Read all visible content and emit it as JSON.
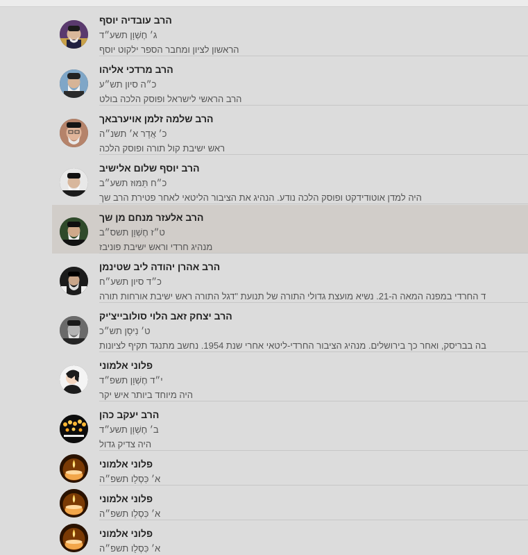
{
  "entries": [
    {
      "name": "הרב עובדיה יוסף",
      "date": "ג׳ חֶשְׁוָן תשע״ד",
      "desc": "הראשון לציון ומחבר הספר ילקוט יוסף",
      "avatar": "rabbi-portrait"
    },
    {
      "name": "הרב מרדכי אליהו",
      "date": "כ״ה סיון תש״ע",
      "desc": "הרב הראשי לישראל ופוסק הלכה בולט",
      "avatar": "rabbi-portrait"
    },
    {
      "name": "הרב שלמה זלמן אויערבאך",
      "date": "כ׳ אֲדָר א׳ תשנ״ה",
      "desc": "ראש ישיבת קול תורה ופוסק הלכה",
      "avatar": "rabbi-portrait"
    },
    {
      "name": "הרב יוסף שלום אלישיב",
      "date": "כ״ח תַּמּוּז תשע״ב",
      "desc": "היה למדן אוטודידקט ופוסק הלכה נודע. הנהיג את הציבור הליטאי לאחר פטירת הרב שך",
      "avatar": "rabbi-portrait"
    },
    {
      "name": "הרב אלעזר מנחם מן שך",
      "date": "ט״ז חֶשְׁוָן תשס״ב",
      "desc": "מנהיג חרדי וראש ישיבת פוניבז",
      "avatar": "rabbi-portrait"
    },
    {
      "name": "הרב אהרן יהודה ליב שטינמן",
      "date": "כ״ד סיון תשע״ח",
      "desc": "ד החרדי במפנה המאה ה-21. נשיא מועצת גדולי התורה של תנועת \"דגל התורה ראש ישיבת אורחות תורה",
      "avatar": "rabbi-portrait"
    },
    {
      "name": "הרב יצחק זאב הלוי סולובייצ'יק",
      "date": "ט׳ נִיסָן תש״כ",
      "desc": "בה בבריסק, ואחר כך בירושלים. מנהיג הציבור החרדי-ליטאי אחרי שנת 1954. נחשב מתנגד תקיף לציונות",
      "avatar": "rabbi-portrait"
    },
    {
      "name": "פלוני אלמוני",
      "date": "י״ד חֶשְׁוָן תשפ״ד",
      "desc": "היה מיוחד ביותר איש יקר",
      "avatar": "person-silhouette"
    },
    {
      "name": "הרב יעקב כהן",
      "date": "ב׳ חֶשְׁוָן תשע״ד",
      "desc": "היה צדיק גדול",
      "avatar": "candles-photo"
    },
    {
      "name": "פלוני אלמוני",
      "date": "א׳ כִּסְלֵו תשפ״ה",
      "desc": "",
      "avatar": "memorial-candle"
    },
    {
      "name": "פלוני אלמוני",
      "date": "א׳ כִּסְלֵו תשפ״ה",
      "desc": "",
      "avatar": "memorial-candle"
    },
    {
      "name": "פלוני אלמוני",
      "date": "א׳ כִּסְלֵו תשפ״ה",
      "desc": "",
      "avatar": "memorial-candle"
    }
  ],
  "selected_index": 4
}
